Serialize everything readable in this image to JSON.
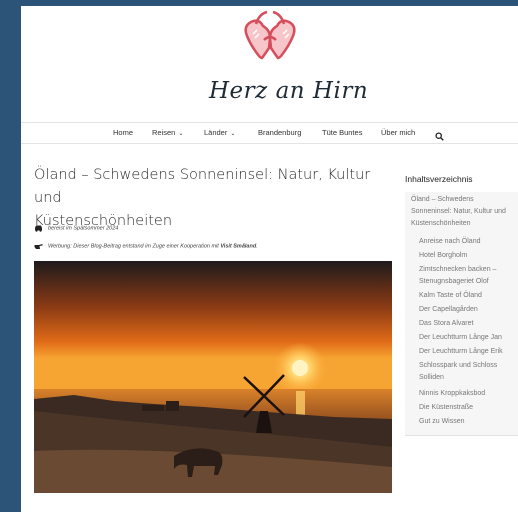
{
  "site": {
    "title": "Herz an Hirn"
  },
  "nav": {
    "items": [
      {
        "label": "Home"
      },
      {
        "label": "Reisen"
      },
      {
        "label": "Länder"
      },
      {
        "label": "Brandenburg"
      },
      {
        "label": "Tüte Buntes"
      },
      {
        "label": "Über mich"
      }
    ]
  },
  "article": {
    "title_line1": "Öland – Schwedens Sonneninsel: Natur, Kultur und",
    "title_line2": "Küstenschönheiten",
    "meta1": "bereist im Spätsommer 2024",
    "meta2_prefix": "Werbung: Dieser Blog-Beitrag entstand im Zuge einer Kooperation mit ",
    "meta2_brand": "Visit Småland",
    "meta2_suffix": "."
  },
  "toc": {
    "heading": "Inhaltsverzeichnis",
    "main_lines": [
      "Öland – Schwedens",
      "Sonneninsel: Natur, Kultur und",
      "Küstenschönheiten"
    ],
    "sub_lines": [
      "Anreise nach Öland",
      "Hotel Borgholm",
      "Zimtschnecken backen –",
      "Stenugnsbageriet Olof",
      "Kalm Taste of Öland",
      "Der Capellagården",
      "Das Stora Alvaret",
      "Der Leuchtturm Långe Jan",
      "Der Leuchtturm Långe Erik",
      "Schlosspark und Schloss",
      "Solliden",
      "Ninnis Kroppkaksbod",
      "Die Küstenstraße",
      "Gut zu Wissen"
    ]
  },
  "colors": {
    "background": "#2b5478",
    "logo_red": "#e05a66"
  }
}
